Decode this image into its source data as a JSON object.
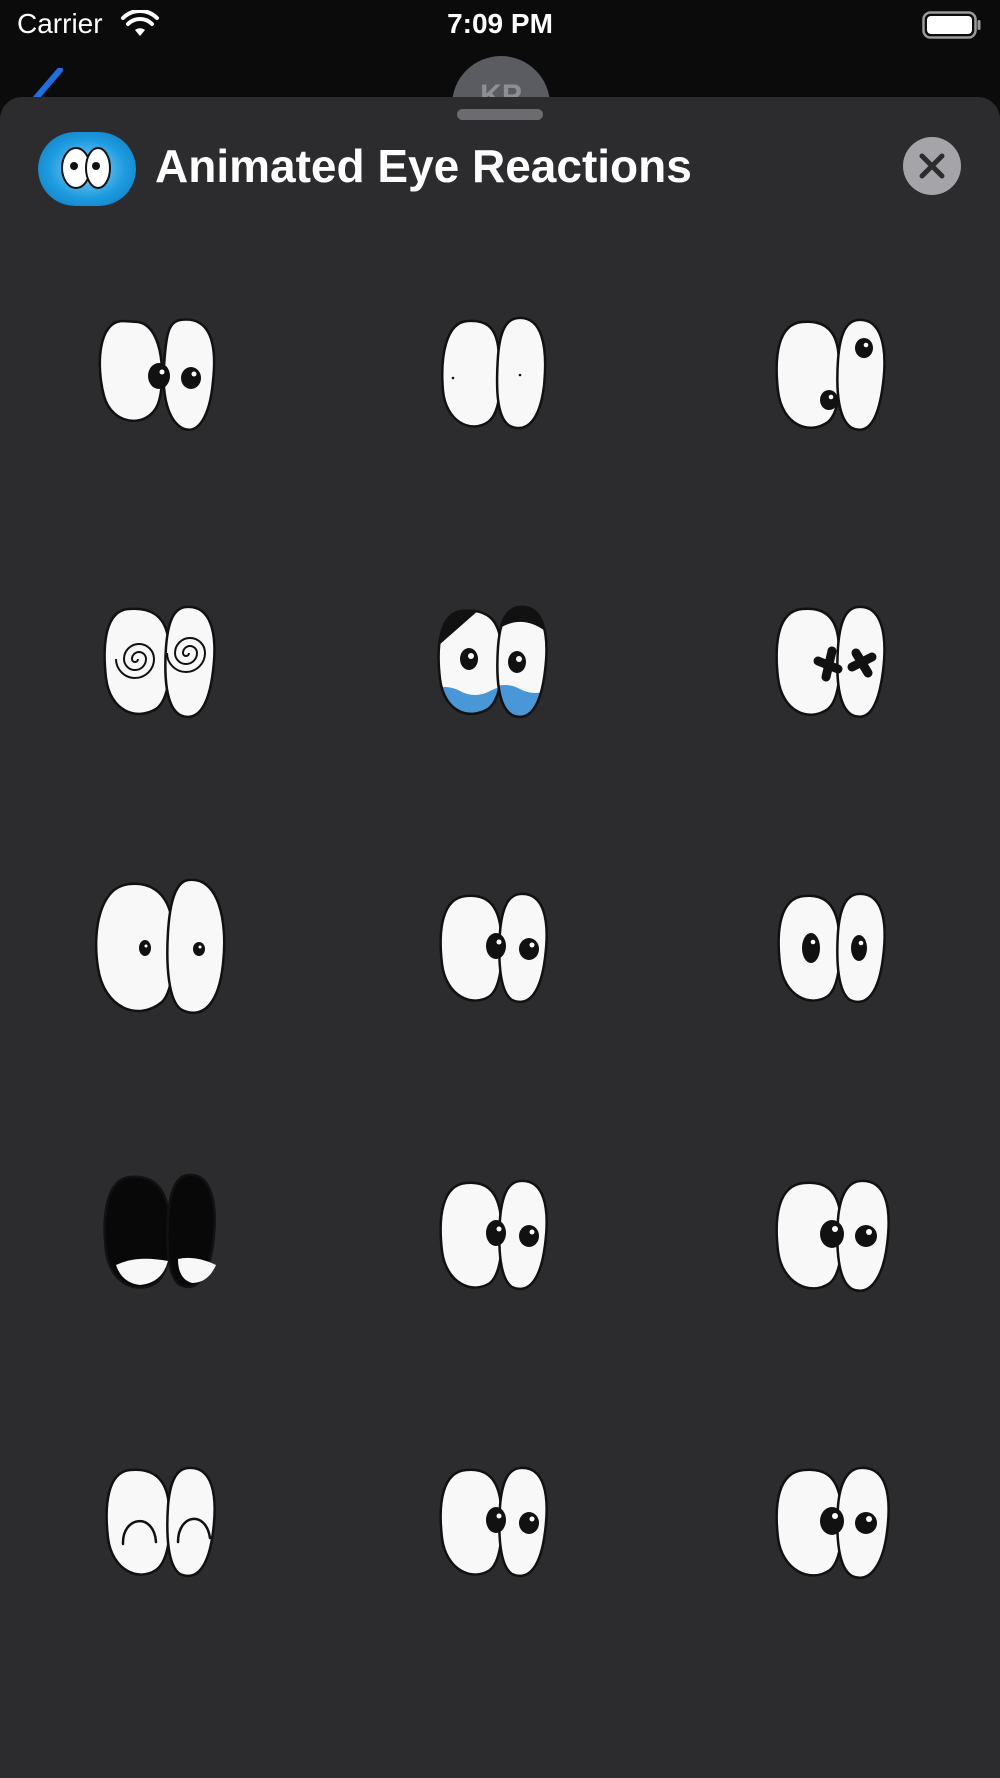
{
  "status_bar": {
    "carrier": "Carrier",
    "time": "7:09 PM",
    "wifi_icon": "wifi-icon",
    "battery_icon": "battery-full-icon"
  },
  "background_conversation": {
    "back_icon": "chevron-left-icon",
    "avatar_initials": "KP"
  },
  "sheet": {
    "app_icon": "eyes-app-icon",
    "title": "Animated Eye Reactions",
    "close_icon": "close-icon"
  },
  "stickers": [
    {
      "name": "eyes-looking-left-sticker"
    },
    {
      "name": "eyes-tiny-pupils-sticker"
    },
    {
      "name": "eyes-looking-around-sticker"
    },
    {
      "name": "eyes-hypnotized-sticker"
    },
    {
      "name": "eyes-crying-sticker"
    },
    {
      "name": "eyes-dizzy-x-sticker"
    },
    {
      "name": "eyes-wide-surprised-sticker"
    },
    {
      "name": "eyes-looking-left-2-sticker"
    },
    {
      "name": "eyes-looking-right-sticker"
    },
    {
      "name": "eyes-closed-dark-sticker"
    },
    {
      "name": "eyes-looking-left-3-sticker"
    },
    {
      "name": "eyes-looking-center-sticker"
    },
    {
      "name": "eyes-happy-arched-sticker"
    },
    {
      "name": "eyes-looking-left-4-sticker"
    },
    {
      "name": "eyes-looking-center-2-sticker"
    }
  ],
  "colors": {
    "sheet_background": "#2c2c2e",
    "status_background": "#0b0b0c",
    "close_button": "#a5a5a9",
    "tear_blue": "#4a97d8",
    "icon_blue": "#1e9be0"
  }
}
